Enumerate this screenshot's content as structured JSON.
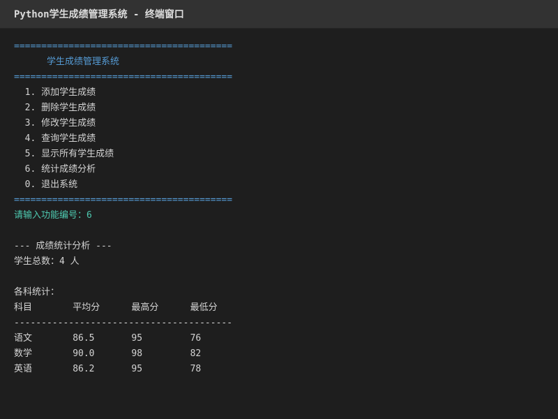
{
  "window": {
    "title": "Python学生成绩管理系统 - 终端窗口"
  },
  "terminal": {
    "separator": "========================================",
    "menu_heading": "      学生成绩管理系统",
    "menu_items": [
      "  1. 添加学生成绩",
      "  2. 删除学生成绩",
      "  3. 修改学生成绩",
      "  4. 查询学生成绩",
      "  5. 显示所有学生成绩",
      "  6. 统计成绩分析",
      "  0. 退出系统"
    ],
    "prompt": "请输入功能编号：6",
    "section_title": "--- 成绩统计分析 ---",
    "student_count": "学生总数：4 人",
    "subjects_heading": "各科统计：",
    "table_header": [
      "科目",
      "平均分",
      "最高分",
      "最低分"
    ],
    "table_divider": "----------------------------------------",
    "table_rows": [
      [
        "语文",
        "86.5",
        "95",
        "76"
      ],
      [
        "数学",
        "90.0",
        "98",
        "82"
      ],
      [
        "英语",
        "86.2",
        "95",
        "78"
      ]
    ]
  }
}
